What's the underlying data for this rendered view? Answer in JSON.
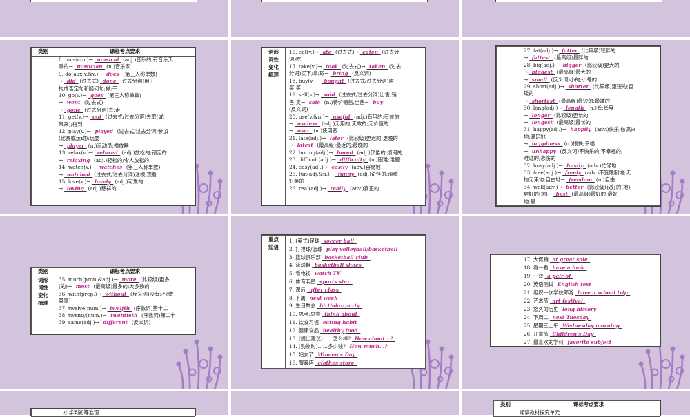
{
  "header": {
    "category": "类别",
    "requirement": "课标考点要求"
  },
  "categories": {
    "vocab": "词形\n词性\n变化\n梳理",
    "phrases": "重点\n短语"
  },
  "card1": [
    [
      [
        "8. music(n.)→"
      ],
      [
        "musical"
      ],
      [
        "(adj.)音乐的;有音乐天"
      ]
    ],
    [
      [
        "赋的→"
      ],
      [
        "musician"
      ],
      [
        "(n.)音乐家"
      ]
    ],
    [
      [
        "9. do(aux v.&v.)→"
      ],
      [
        "does"
      ],
      [
        "(第三人称单数)"
      ]
    ],
    [
      [
        "→"
      ],
      [
        "did"
      ],
      [
        "(过去式)"
      ],
      [
        "done"
      ],
      [
        "(过去分词)用于"
      ]
    ],
    [
      [
        "构成否定句和疑问句;做;干"
      ]
    ],
    [
      [
        "10. go(v.)→"
      ],
      [
        "goes"
      ],
      [
        "(第三人称单数)"
      ]
    ],
    [
      [
        "→"
      ],
      [
        "went"
      ],
      [
        "(过去式)"
      ]
    ],
    [
      [
        "→"
      ],
      [
        "gone"
      ],
      [
        "(过去分词)去;走"
      ]
    ],
    [
      [
        "11. get(v.)→"
      ],
      [
        "got"
      ],
      [
        "(过去式/过去分词)去取(或"
      ]
    ],
    [
      [
        "带来);得到"
      ]
    ],
    [
      [
        "12. play(v.)→"
      ],
      [
        "played"
      ],
      [
        "(过去式/过去分词)参加"
      ]
    ],
    [
      [
        "(比赛或运动);玩耍"
      ]
    ],
    [
      [
        "→"
      ],
      [
        "player"
      ],
      [
        "(n.)运动员;播放器"
      ]
    ],
    [
      [
        "13. relax(v.)→"
      ],
      [
        "relaxed"
      ],
      [
        "(adj.)放松的;镇定的"
      ]
    ],
    [
      [
        "→"
      ],
      [
        "relaxing"
      ],
      [
        "(adj.)轻松的;令人放松的"
      ]
    ],
    [
      [
        "14. watch(v.)→"
      ],
      [
        "watches"
      ],
      [
        "(第三人称单数)"
      ]
    ],
    [
      [
        "→"
      ],
      [
        "watched"
      ],
      [
        "(过去式/过去分词)注视;观看"
      ]
    ],
    [
      [
        "15. love(v.)→"
      ],
      [
        "lovely"
      ],
      [
        "(adj.)可爱的"
      ]
    ],
    [
      [
        "→"
      ],
      [
        "loving"
      ],
      [
        "(adj.)慈祥的"
      ]
    ]
  ],
  "card2": [
    [
      [
        "16. eat(v.)→"
      ],
      [
        "ate"
      ],
      [
        "(过去式)→"
      ],
      [
        "eaten"
      ],
      [
        "(过去分"
      ]
    ],
    [
      [
        "词)吃"
      ]
    ],
    [
      [
        "17. take(v.)→"
      ],
      [
        "took"
      ],
      [
        "(过去式)→"
      ],
      [
        "taken"
      ],
      [
        "(过去"
      ]
    ],
    [
      [
        "分词)买下;拿;取→"
      ],
      [
        "bring"
      ],
      [
        "(反义词)"
      ]
    ],
    [
      [
        "18. buy(v.)→"
      ],
      [
        "bought"
      ],
      [
        "(过去式/过去分词)购"
      ]
    ],
    [
      [
        "买;买"
      ]
    ],
    [
      [
        "19. sell(v.)→"
      ],
      [
        "sold"
      ],
      [
        "(过去式/过去分词)出售;销"
      ]
    ],
    [
      [
        "售;卖→"
      ],
      [
        "sale"
      ],
      [
        "(n.)特价销售,出售→"
      ],
      [
        "buy"
      ]
    ],
    [
      [
        "(反义词)"
      ]
    ],
    [
      [
        "20. use(v.&n.)→"
      ],
      [
        "useful"
      ],
      [
        "(adj.)有用的;有益的"
      ]
    ],
    [
      [
        "→"
      ],
      [
        "useless"
      ],
      [
        "(adj.)无用的;无效的;无价值的"
      ]
    ],
    [
      [
        "→"
      ],
      [
        "user"
      ],
      [
        "(n.)使用者"
      ]
    ],
    [
      [
        "21. late(adj.)→"
      ],
      [
        "later"
      ],
      [
        "(比较级)更迟的;更晚的"
      ]
    ],
    [
      [
        "→"
      ],
      [
        "latest"
      ],
      [
        "(最高级)最近的;最晚的"
      ]
    ],
    [
      [
        "22. boring(adj.)→"
      ],
      [
        "bored"
      ],
      [
        "(adj.)厌倦的;烦闷的"
      ]
    ],
    [
      [
        "23. difficult(adj.)→"
      ],
      [
        "difficulty"
      ],
      [
        "(n.)困难;难题"
      ]
    ],
    [
      [
        "24. easy(adj.)→"
      ],
      [
        "easily"
      ],
      [
        "(adv.)容易地"
      ]
    ],
    [
      [
        "25. fun(adj.&n.)→"
      ],
      [
        "funny"
      ],
      [
        "(adj.)奇怪的;滑稽"
      ]
    ],
    [
      [
        "好笑的"
      ]
    ],
    [
      [
        "26. real(adj.)→"
      ],
      [
        "really"
      ],
      [
        "(adv.)真正的"
      ]
    ]
  ],
  "card3": [
    [
      [
        "27. fat(adj.)→"
      ],
      [
        "fatter"
      ],
      [
        "(比较级)较胖的"
      ]
    ],
    [
      [
        "→"
      ],
      [
        "fattest"
      ],
      [
        "(最高级)最胖的"
      ]
    ],
    [
      [
        "28. big(adj.)→"
      ],
      [
        "bigger"
      ],
      [
        "(比较级)更大的"
      ]
    ],
    [
      [
        "→"
      ],
      [
        "biggest"
      ],
      [
        "(最高级)最大的"
      ]
    ],
    [
      [
        "→"
      ],
      [
        "small"
      ],
      [
        "(反义词)小的;小号的"
      ]
    ],
    [
      [
        "29. short(adj.)→"
      ],
      [
        "shorter"
      ],
      [
        "(比较级)更短的;更"
      ]
    ],
    [
      [
        "矮的"
      ]
    ],
    [
      [
        "→"
      ],
      [
        "shortest"
      ],
      [
        "(最高级)最短的;最矮的"
      ]
    ],
    [
      [
        "30. long(adj.)→"
      ],
      [
        "length"
      ],
      [
        "(n.)长;长度"
      ]
    ],
    [
      [
        "→"
      ],
      [
        "longer"
      ],
      [
        "(比较级)更长的"
      ]
    ],
    [
      [
        "→"
      ],
      [
        "longest"
      ],
      [
        "(最高级)最长的"
      ]
    ],
    [
      [
        "31. happy(adj.)→"
      ],
      [
        "happily"
      ],
      [
        "(adv.)快乐地;高兴"
      ]
    ],
    [
      [
        "地;满足地"
      ]
    ],
    [
      [
        "→"
      ],
      [
        "happiness"
      ],
      [
        "(n.)愉快;幸福"
      ]
    ],
    [
      [
        "→"
      ],
      [
        "unhappy"
      ],
      [
        "(反义词)不快乐的;不幸福的;"
      ]
    ],
    [
      [
        "难过的;悲伤的"
      ]
    ],
    [
      [
        "32. busy(adj.)→"
      ],
      [
        "busily"
      ],
      [
        "(adv.)忙碌地"
      ]
    ],
    [
      [
        "33. free(adj.)→"
      ],
      [
        "freely"
      ],
      [
        "(adv.)不受限制地;无"
      ]
    ],
    [
      [
        "拘无束地;自由地→"
      ],
      [
        "freedom"
      ],
      [
        "(n.)自由"
      ]
    ],
    [
      [
        "34. well(adv.)→"
      ],
      [
        "better"
      ],
      [
        "(比较级)较好的(地);"
      ]
    ],
    [
      [
        "更好的(地)→"
      ],
      [
        "best"
      ],
      [
        "(最高级)最好的;最好"
      ]
    ],
    [
      [
        "地;最"
      ]
    ]
  ],
  "card4": [
    [
      [
        "35. much(pron.&adj.)→"
      ],
      [
        "more"
      ],
      [
        "(比较级)更多"
      ]
    ],
    [
      [
        "(的)→"
      ],
      [
        "most"
      ],
      [
        "(最高级)最多的;大多数的"
      ]
    ],
    [
      [
        "36. with(prep.)→"
      ],
      [
        "without"
      ],
      [
        "(反义词)没有;不(做"
      ]
    ],
    [
      [
        "某事)"
      ]
    ],
    [
      [
        "37. twelve(num.)→"
      ],
      [
        "twelfth"
      ],
      [
        "(序数词)第十二"
      ]
    ],
    [
      [
        "38. twenty(num.)→"
      ],
      [
        "twentieth"
      ],
      [
        "(序数词)第二十"
      ]
    ],
    [
      [
        "39. same(adj.)→"
      ],
      [
        "different"
      ],
      [
        "(反义词)"
      ]
    ]
  ],
  "phrases1": [
    [
      [
        "1. (英式)足球"
      ],
      [
        "soccer ball"
      ]
    ],
    [
      [
        "2. 打排球/篮球"
      ],
      [
        "play volleyball/basketball"
      ]
    ],
    [
      [
        "3. 篮球俱乐部"
      ],
      [
        "basketball club"
      ]
    ],
    [
      [
        "4. 篮球鞋"
      ],
      [
        "basketball shoes"
      ]
    ],
    [
      [
        "5. 看电视"
      ],
      [
        "watch TV"
      ]
    ],
    [
      [
        "6. 体育明星"
      ],
      [
        "sports star"
      ]
    ],
    [
      [
        "7. 课后"
      ],
      [
        "after class"
      ]
    ],
    [
      [
        "8. 下周"
      ],
      [
        "next week"
      ]
    ],
    [
      [
        "9. 生日聚会"
      ],
      [
        "birthday party"
      ]
    ],
    [
      [
        "10. 思考;思索"
      ],
      [
        "think about"
      ]
    ],
    [
      [
        "11. 饮食习惯"
      ],
      [
        "eating habit"
      ]
    ],
    [
      [
        "12. 健康食品"
      ],
      [
        "healthy food"
      ]
    ],
    [
      [
        "13. (提出建议)……怎么样?"
      ],
      [
        "How about…?"
      ]
    ],
    [
      [
        "14. (购物时)……多少钱?"
      ],
      [
        "How much…?"
      ]
    ],
    [
      [
        "15. 妇女节"
      ],
      [
        "Women's Day"
      ]
    ],
    [
      [
        "16. 服装店"
      ],
      [
        "clothes store"
      ]
    ]
  ],
  "phrases2": [
    [
      [
        "17. 大促销"
      ],
      [
        "at great sale"
      ]
    ],
    [
      [
        "18. 看一看"
      ],
      [
        "have a look"
      ]
    ],
    [
      [
        "19. 一双"
      ],
      [
        "a pair of"
      ]
    ],
    [
      [
        "20. 英语测试"
      ],
      [
        "English test"
      ]
    ],
    [
      [
        "21. 组织一次学校郊游"
      ],
      [
        "have a school trip"
      ]
    ],
    [
      [
        "22. 艺术节"
      ],
      [
        "art festival"
      ]
    ],
    [
      [
        "23. 悠久的历史"
      ],
      [
        "long history"
      ]
    ],
    [
      [
        "24. 下周二"
      ],
      [
        "next Tuesday"
      ]
    ],
    [
      [
        "25. 星期三上午"
      ],
      [
        "Wednesday morning"
      ]
    ],
    [
      [
        "26. 儿童节"
      ],
      [
        "Children's Day"
      ]
    ],
    [
      [
        "27. 最喜欢的学科"
      ],
      [
        "favorite subject"
      ]
    ]
  ],
  "bottom_left": [
    "1. 小学到初等准理"
  ],
  "bottom_right": [
    "通读教材探究单元"
  ],
  "colors": {
    "slide": "#d3c3dd",
    "answer": "#c0268c",
    "flower": "#a77cc6"
  }
}
